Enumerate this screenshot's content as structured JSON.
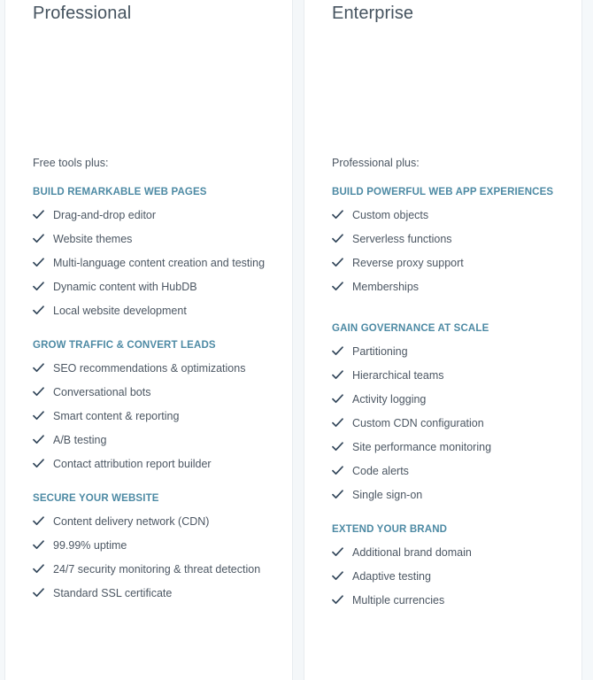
{
  "theme": {
    "page_background": "#f5f8fa",
    "card_background": "#ffffff",
    "heading_accent": "#4d8aa4",
    "body_text": "#4c5763",
    "title_text": "#45535f",
    "check_icon": "#33475b",
    "divider": "#e8ecef"
  },
  "icons": {
    "check": "check-icon"
  },
  "columns": [
    {
      "id": "professional",
      "title": "Professional",
      "intro": "Free tools plus:",
      "groups": [
        {
          "heading": "BUILD REMARKABLE WEB PAGES",
          "features": [
            "Drag-and-drop editor",
            "Website themes",
            "Multi-language content creation and testing",
            "Dynamic content with HubDB",
            "Local website development"
          ]
        },
        {
          "heading": "GROW TRAFFIC & CONVERT LEADS",
          "features": [
            "SEO recommendations & optimizations",
            "Conversational bots",
            "Smart content & reporting",
            "A/B testing",
            "Contact attribution report builder"
          ]
        },
        {
          "heading": "SECURE YOUR WEBSITE",
          "features": [
            "Content delivery network (CDN)",
            "99.99% uptime",
            "24/7 security monitoring & threat detection",
            "Standard SSL certificate"
          ]
        }
      ]
    },
    {
      "id": "enterprise",
      "title": "Enterprise",
      "intro": "Professional plus:",
      "groups": [
        {
          "heading": "BUILD POWERFUL WEB APP EXPERIENCES",
          "features": [
            "Custom objects",
            "Serverless functions",
            "Reverse proxy support",
            "Memberships"
          ]
        },
        {
          "heading": "GAIN GOVERNANCE AT SCALE",
          "features": [
            "Partitioning",
            "Hierarchical teams",
            "Activity logging",
            "Custom CDN configuration",
            "Site performance monitoring",
            "Code alerts",
            "Single sign-on"
          ]
        },
        {
          "heading": "EXTEND YOUR BRAND",
          "features": [
            "Additional brand domain",
            "Adaptive testing",
            "Multiple currencies"
          ]
        }
      ]
    }
  ]
}
